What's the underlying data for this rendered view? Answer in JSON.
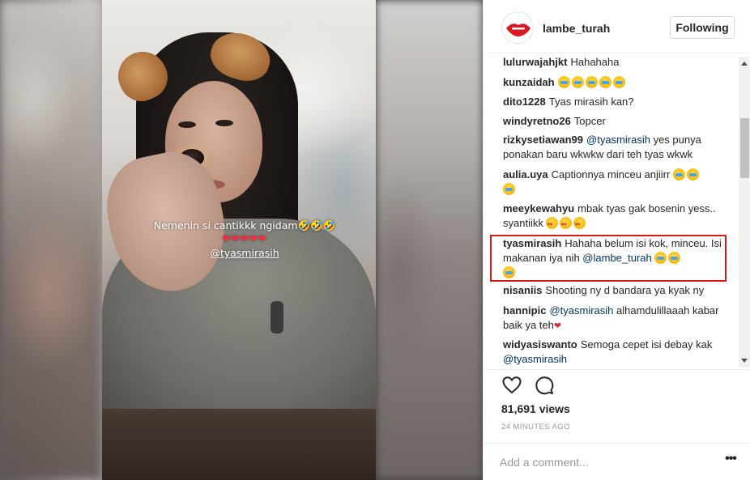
{
  "story": {
    "caption": "Nemenin si cantikkk ngidam🤣🤣🤣",
    "hearts": "❤❤❤❤❤",
    "mention": "@tyasmirasih"
  },
  "post": {
    "username": "lambe_turah",
    "follow_label": "Following",
    "views": "81,691 views",
    "time": "24 MINUTES AGO",
    "comment_placeholder": "Add a comment...",
    "more_label": "•••"
  },
  "comments": [
    {
      "user": "lulurwajahjkt",
      "text": "Hahahaha"
    },
    {
      "user": "kunzaidah",
      "text": ""
    },
    {
      "user": "dito1228",
      "text": "Tyas mirasih kan?"
    },
    {
      "user": "windyretno26",
      "text": "Topcer"
    },
    {
      "user": "rizkysetiawan99",
      "mention": "@tyasmirasih",
      "text": "yes punya ponakan baru wkwkw dari teh tyas wkwk"
    },
    {
      "user": "aulia.uya",
      "text": "Captionnya minceu anjiirr"
    },
    {
      "user": "meeykewahyu",
      "text": "mbak tyas gak bosenin yess.. syantiikk"
    },
    {
      "user": "tyasmirasih",
      "text": "Hahaha belum isi kok, minceu. Isi makanan iya nih",
      "mention": "@lambe_turah"
    },
    {
      "user": "nisaniis",
      "text": "Shooting ny d bandara ya kyak ny"
    },
    {
      "user": "hannipic",
      "mention": "@tyasmirasih",
      "text": "alhamdulillaaah kabar baik ya teh"
    },
    {
      "user": "widyasiswanto",
      "text": "Semoga cepet isi debay kak",
      "mention": "@tyasmirasih"
    }
  ],
  "icons": {
    "like": "heart-outline",
    "comment": "speech-bubble",
    "avatar": "red-lips-logo"
  },
  "colors": {
    "highlight": "#d8191c",
    "link": "#003569"
  }
}
